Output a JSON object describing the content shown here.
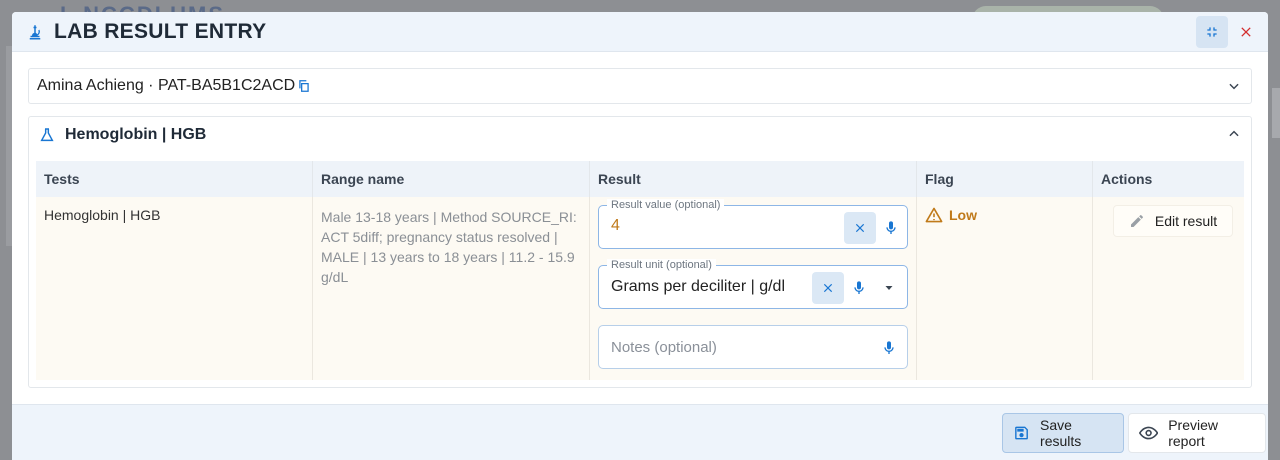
{
  "background": {
    "brand_text": "L NCCDLUMS"
  },
  "dialog": {
    "title": "LAB RESULT ENTRY",
    "patient": {
      "label": "Amina Achieng · PAT-BA5B1C2ACD"
    },
    "test": {
      "title": "Hemoglobin | HGB",
      "columns": [
        "Tests",
        "Range name",
        "Result",
        "Flag",
        "Actions"
      ],
      "row": {
        "test_name": "Hemoglobin | HGB",
        "range_name": "Male 13-18 years | Method SOURCE_RI: ACT 5diff; pregnancy status resolved | MALE | 13 years to 18 years | 11.2 - 15.9 g/dL",
        "result_value_label": "Result value",
        "result_value_optional": "(optional)",
        "result_value": "4",
        "result_unit_label": "Result unit",
        "result_unit_optional": "(optional)",
        "result_unit": "Grams per deciliter | g/dl",
        "notes_placeholder": "Notes (optional)",
        "flag": "Low",
        "action_label": "Edit result"
      }
    },
    "footer": {
      "save_label": "Save results",
      "preview_label": "Preview report"
    }
  },
  "colors": {
    "accent": "#1976d2",
    "warning": "#c07a1a",
    "close": "#d32f2f"
  }
}
